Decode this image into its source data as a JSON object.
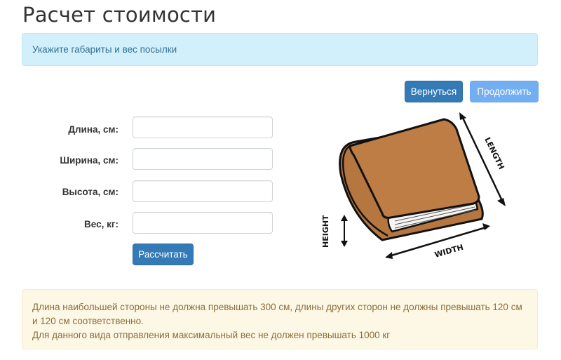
{
  "page": {
    "title": "Расчет стоимости",
    "info_message": "Укажите габариты и вес посылки"
  },
  "actions": {
    "back_label": "Вернуться",
    "next_label": "Продолжить",
    "calculate_label": "Рассчитать"
  },
  "form": {
    "length": {
      "label": "Длина, см:",
      "value": ""
    },
    "width": {
      "label": "Ширина, см:",
      "value": ""
    },
    "height": {
      "label": "Высота, см:",
      "value": ""
    },
    "weight": {
      "label": "Вес, кг:",
      "value": ""
    }
  },
  "illustration": {
    "length_label": "LENGTH",
    "width_label": "WIDTH",
    "height_label": "HEIGHT"
  },
  "warning": {
    "line1": "Длина наибольшей стороны не должна превышать 300 см, длины других сторон не должны превышать 120 см и 120 см соответственно.",
    "line2": "Для данного вида отправления максимальный вес не должен превышать 1000 кг"
  },
  "colors": {
    "primary": "#337ab7",
    "primary_light": "#73aef0",
    "info_bg": "#d1f0fb",
    "warning_bg": "#fdf8e5",
    "book_cover": "#b5773f"
  }
}
